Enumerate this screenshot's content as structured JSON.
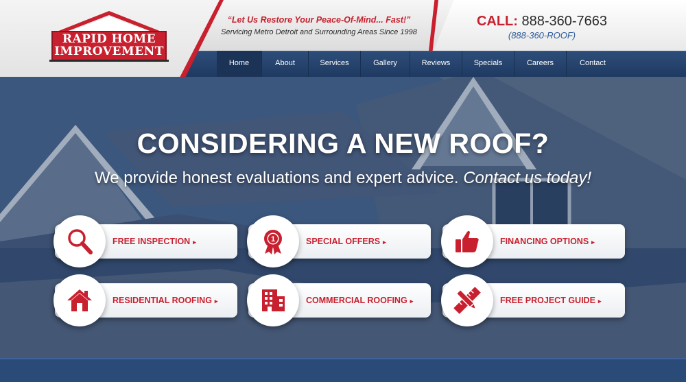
{
  "brand": {
    "logo_line1": "RAPID HOME",
    "logo_line2": "IMPROVEMENT",
    "red": "#c8202e",
    "navy": "#1f3a62"
  },
  "header": {
    "slogan": "“Let Us Restore Your Peace-Of-Mind... Fast!”",
    "tagline": "Servicing Metro Detroit and Surrounding Areas Since 1998",
    "call_label": "CALL:",
    "phone": "888-360-7663",
    "phone_alt": "(888-360-ROOF)"
  },
  "nav": {
    "items": [
      {
        "label": "Home",
        "active": true
      },
      {
        "label": "About"
      },
      {
        "label": "Services"
      },
      {
        "label": "Gallery"
      },
      {
        "label": "Reviews"
      },
      {
        "label": "Specials"
      },
      {
        "label": "Careers"
      },
      {
        "label": "Contact"
      }
    ]
  },
  "hero": {
    "title": "CONSIDERING A NEW ROOF?",
    "subtitle": "We provide honest evaluations and expert advice.",
    "subtitle_em": "Contact us today!"
  },
  "cards": [
    {
      "label": "FREE INSPECTION",
      "icon": "magnifier-icon"
    },
    {
      "label": "SPECIAL OFFERS",
      "icon": "award-ribbon-icon"
    },
    {
      "label": "FINANCING OPTIONS",
      "icon": "thumbs-up-icon"
    },
    {
      "label": "RESIDENTIAL ROOFING",
      "icon": "house-icon"
    },
    {
      "label": "COMMERCIAL ROOFING",
      "icon": "building-icon"
    },
    {
      "label": "FREE PROJECT GUIDE",
      "icon": "pencil-ruler-icon"
    }
  ],
  "card_arrow": "▸"
}
